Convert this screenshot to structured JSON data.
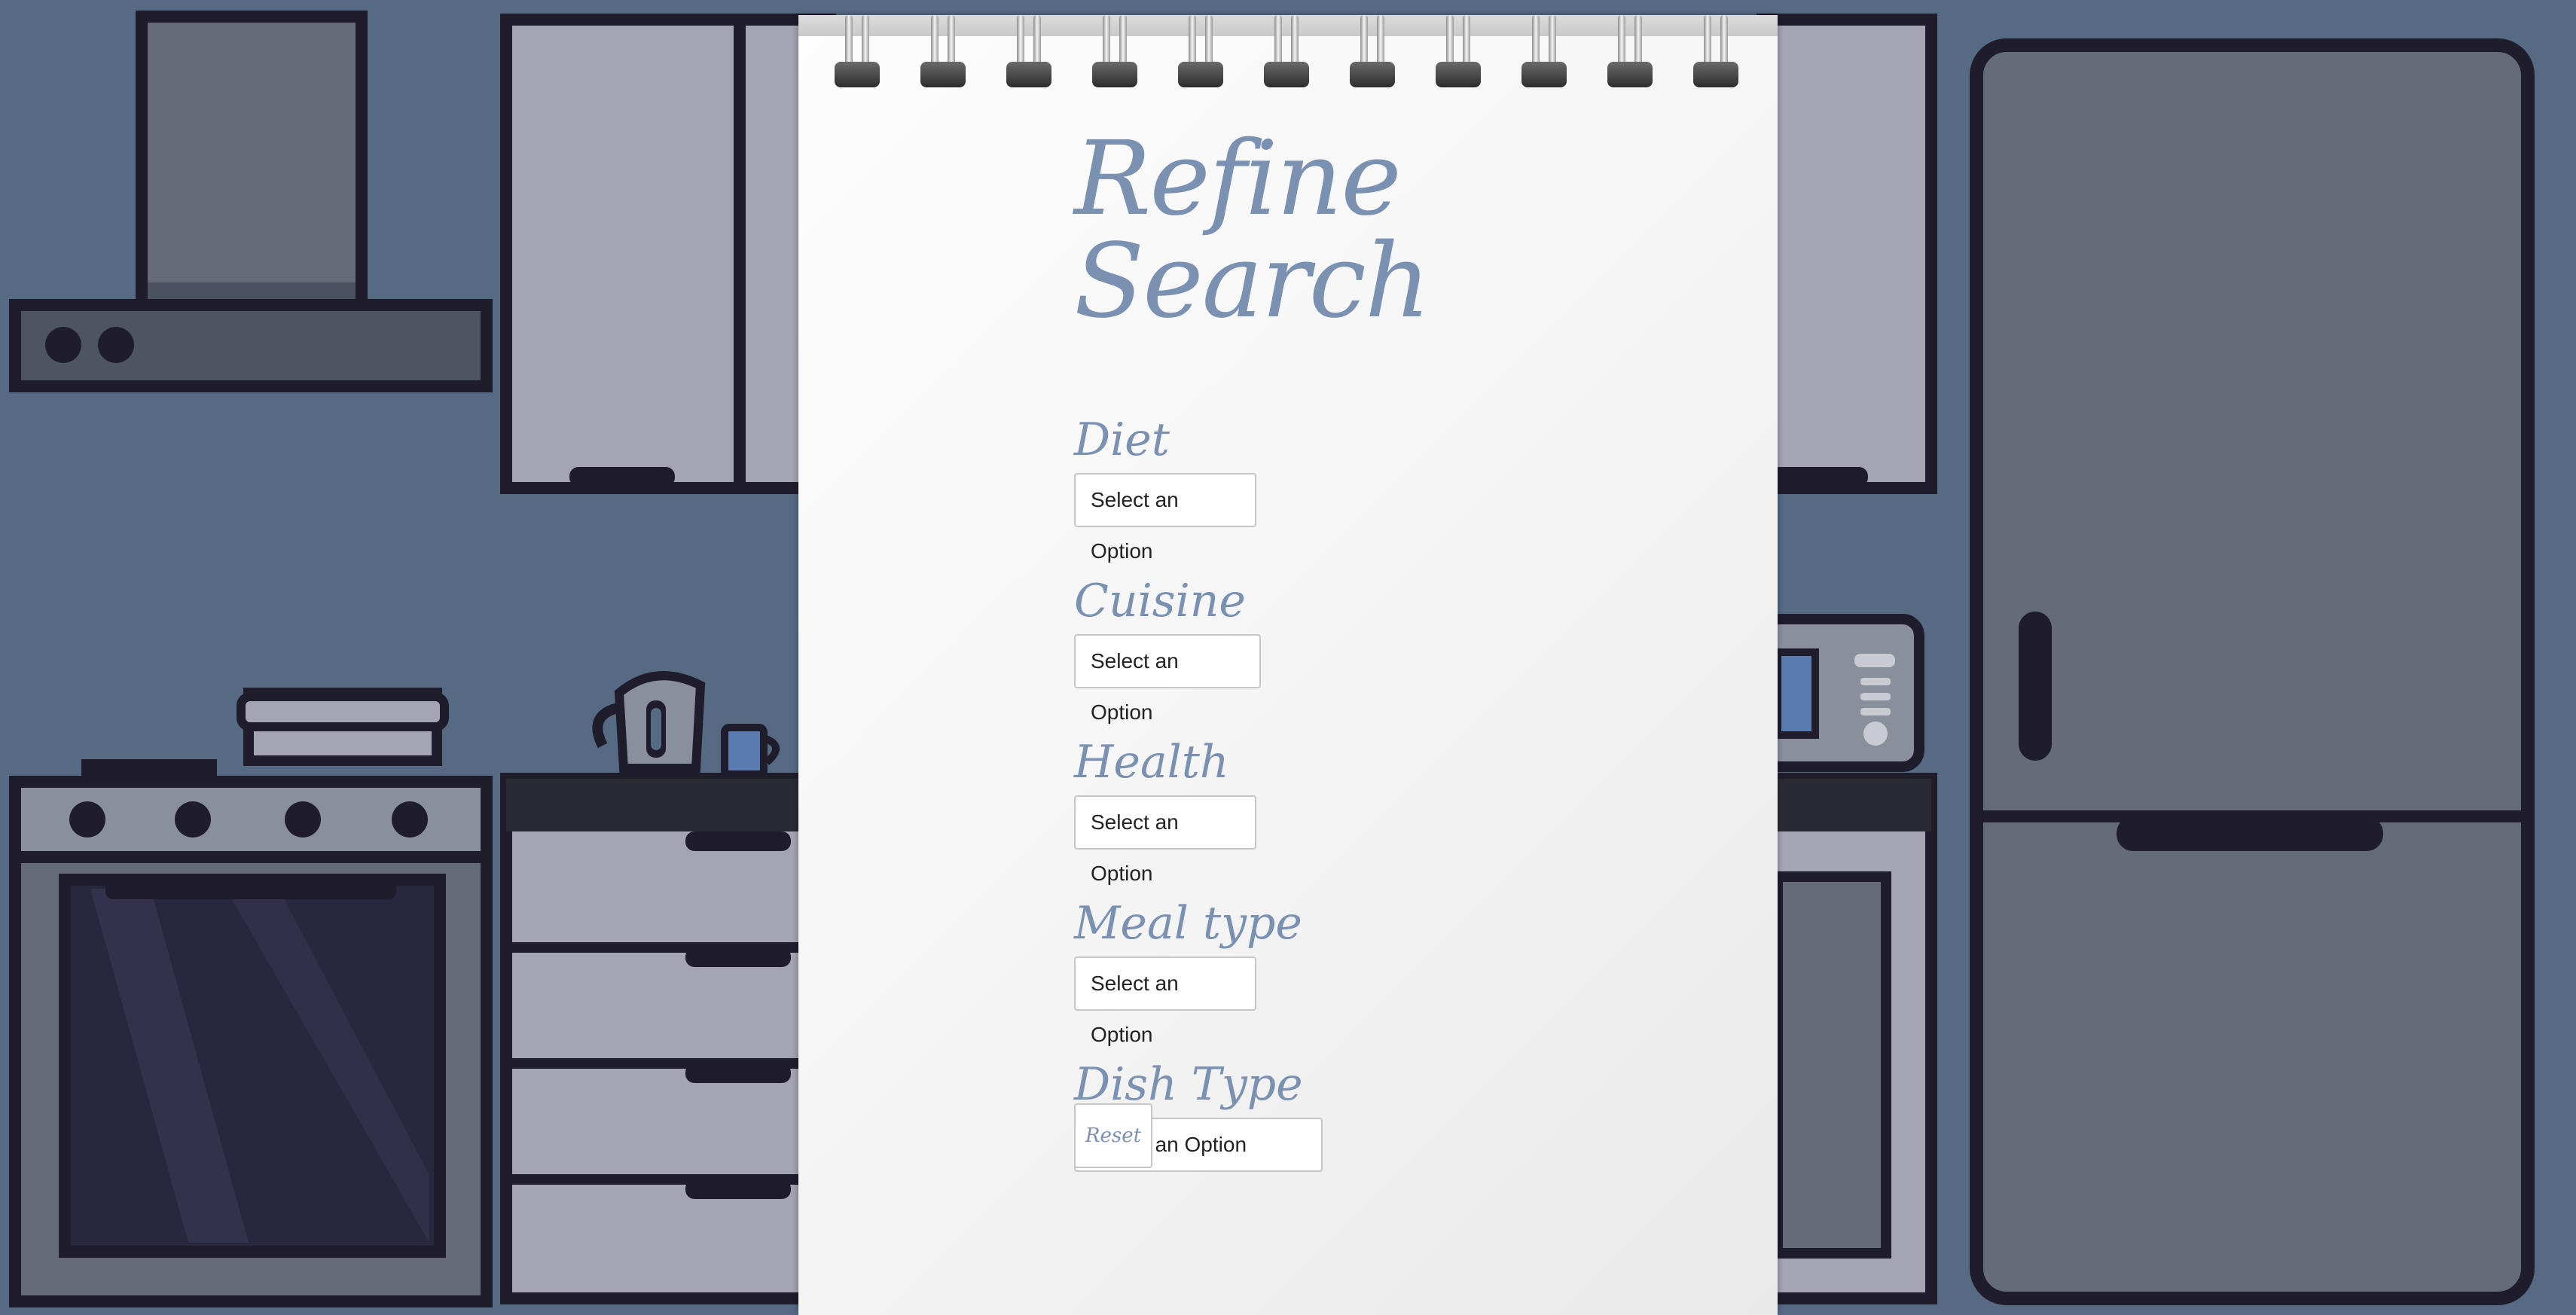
{
  "page": {
    "title": "Refine Search"
  },
  "filters": [
    {
      "label": "Diet",
      "value": "Select an Option"
    },
    {
      "label": "Cuisine",
      "value": "Select an Option"
    },
    {
      "label": "Health",
      "value": "Select an Option"
    },
    {
      "label": "Meal type",
      "value": "Select an Option"
    },
    {
      "label": "Dish Type",
      "value": "Select an Option"
    }
  ],
  "actions": {
    "reset_label": "Reset"
  },
  "colors": {
    "background": "#566a84",
    "accent": "#7a91b2",
    "paper": "#f4f4f4"
  }
}
